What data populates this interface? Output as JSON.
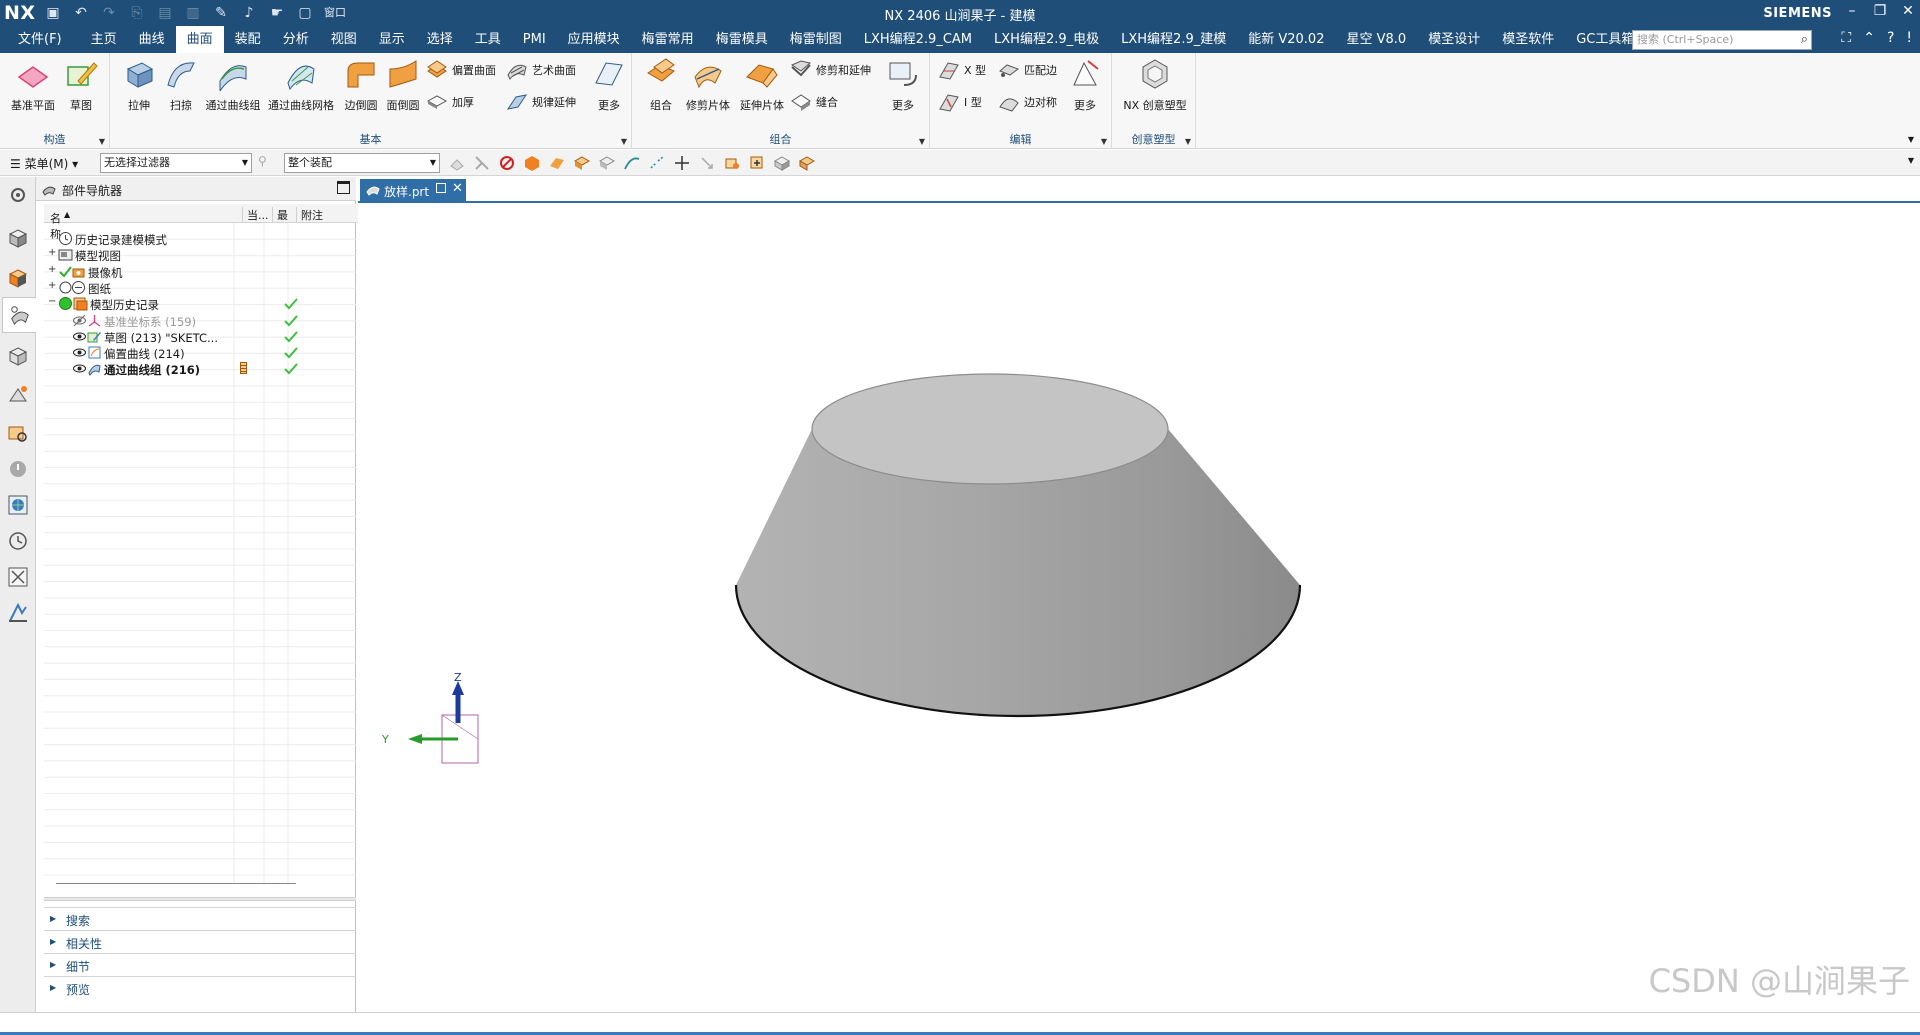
{
  "app": {
    "logo": "NX",
    "title": "NX 2406 山涧果子 - 建模",
    "brand": "SIEMENS"
  },
  "quick_access": [
    "save-icon",
    "undo-icon",
    "redo-icon",
    "copy-icon",
    "paste-icon",
    "clipboard-icon",
    "brush-icon",
    "microphone-icon",
    "touch-icon",
    "window-icon"
  ],
  "quick_access_window_label": "窗口",
  "menubar": {
    "tabs": [
      "文件(F)",
      "主页",
      "曲线",
      "曲面",
      "装配",
      "分析",
      "视图",
      "显示",
      "选择",
      "工具",
      "PMI",
      "应用模块",
      "梅雷常用",
      "梅雷模具",
      "梅雷制图",
      "LXH编程2.9_CAM",
      "LXH编程2.9_电极",
      "LXH编程2.9_建模",
      "能新 V20.02",
      "星空 V8.0",
      "模圣设计",
      "模圣软件",
      "GC工具箱"
    ],
    "active_index": 3,
    "search_placeholder": "搜索 (Ctrl+Space)"
  },
  "ribbon": {
    "groups": [
      {
        "label": "构造",
        "buttons": [
          "基准平面",
          "草图"
        ]
      },
      {
        "label": "基本",
        "buttons": [
          "拉伸",
          "扫掠",
          "通过曲线组",
          "通过曲线网格",
          "边倒圆",
          "面倒圆"
        ],
        "small": [
          "偏置曲面",
          "加厚",
          "艺术曲面",
          "规律延伸"
        ],
        "more": "更多"
      },
      {
        "label": "组合",
        "buttons": [
          "组合",
          "修剪片体",
          "延伸片体"
        ],
        "small": [
          "修剪和延伸",
          "缝合"
        ],
        "more": "更多"
      },
      {
        "label": "编辑",
        "small": [
          "X 型",
          "I 型",
          "匹配边",
          "边对称"
        ],
        "more": "更多"
      },
      {
        "label": "创意塑型",
        "buttons": [
          "NX 创意塑型"
        ]
      }
    ]
  },
  "selection_bar": {
    "menu_label": "菜单(M)",
    "filter": "无选择过滤器",
    "scope": "整个装配"
  },
  "navigator": {
    "title": "部件导航器",
    "columns": [
      "名称",
      "当...",
      "最",
      "附注"
    ],
    "rows": [
      {
        "label": "历史记录建模模式",
        "indent": 0,
        "expand": "",
        "check": false,
        "icon": "clock-icon",
        "style": "normal"
      },
      {
        "label": "模型视图",
        "indent": 0,
        "expand": "+",
        "check": false,
        "icon": "model-view-icon",
        "style": "normal"
      },
      {
        "label": "摄像机",
        "indent": 0,
        "expand": "+",
        "check": false,
        "icon": "camera-icon",
        "style": "normal"
      },
      {
        "label": "图纸",
        "indent": 0,
        "expand": "+",
        "check": false,
        "icon": "drawing-icon",
        "style": "normal"
      },
      {
        "label": "模型历史记录",
        "indent": 0,
        "expand": "−",
        "check": true,
        "icon": "history-icon",
        "style": "normal"
      },
      {
        "label": "基准坐标系 (159)",
        "indent": 1,
        "expand": "",
        "check": true,
        "icon": "csys-icon",
        "style": "dim"
      },
      {
        "label": "草图 (213) \"SKETC...",
        "indent": 1,
        "expand": "",
        "check": true,
        "icon": "sketch-icon",
        "style": "normal"
      },
      {
        "label": "偏置曲线 (214)",
        "indent": 1,
        "expand": "",
        "check": true,
        "icon": "offset-curve-icon",
        "style": "normal"
      },
      {
        "label": "通过曲线组 (216)",
        "indent": 1,
        "expand": "",
        "check": true,
        "icon": "through-curves-icon",
        "style": "bold"
      }
    ],
    "accordion": [
      "搜索",
      "相关性",
      "细节",
      "预览"
    ]
  },
  "graphics": {
    "tab_name": "放样.prt",
    "axis_z": "Z",
    "axis_y": "Y",
    "watermark": "CSDN @山涧果子"
  },
  "colors": {
    "accent": "#1f4e79",
    "tab_active": "#2f6ea6",
    "check_green": "#3fbf3f"
  }
}
